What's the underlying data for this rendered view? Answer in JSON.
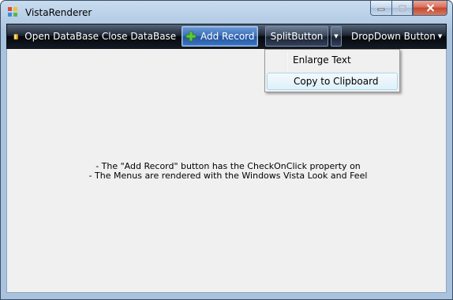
{
  "window": {
    "title": "VistaRenderer",
    "icons": {
      "app": "app-icon",
      "minimize": "minimize-icon",
      "maximize": "maximize-icon",
      "close": "close-icon"
    }
  },
  "toolbar": {
    "open_label": "Open DataBase",
    "open_icon": "database-icon",
    "close_label": "Close DataBase",
    "add_label": "Add Record",
    "add_icon": "plus-icon",
    "add_checked": true,
    "split_label": "SplitButton",
    "split_arrow_icon": "chevron-down-icon",
    "dropdown_label": "DropDown Button",
    "dropdown_arrow_icon": "chevron-down-icon"
  },
  "menu": {
    "items": [
      {
        "label": "Enlarge Text",
        "highlighted": false
      },
      {
        "label": "Copy to Clipboard",
        "highlighted": true
      }
    ]
  },
  "content": {
    "lines": [
      "- The \"Add Record\" button has the CheckOnClick property on",
      "- The Menus are rendered with the Windows Vista Look and Feel"
    ]
  },
  "colors": {
    "toolbar_bg": "#131a25",
    "checked_button": "#3d6fb6",
    "menu_highlight": "#dff1fa",
    "content_bg": "#f0f0f0"
  }
}
